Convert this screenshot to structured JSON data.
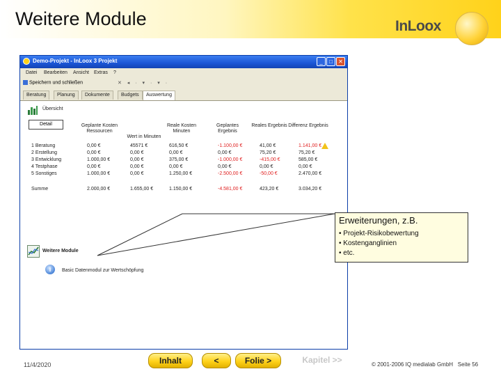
{
  "slide": {
    "title": "Weitere Module",
    "logo": "InLoox"
  },
  "window": {
    "title": "Demo-Projekt - InLoox 3 Projekt",
    "menu": [
      "Datei",
      "Bearbeiten",
      "Ansicht",
      "Extras",
      "?"
    ],
    "toolbar_save": "Speichern und schließen",
    "toolbar_icons": "✕ ◂ · ▾ · ▾ ·",
    "tabs": [
      "Beratung",
      "Planung",
      "Dokumente",
      "Budgets",
      "Auswertung"
    ],
    "overview_label": "Übersicht",
    "overview_button": "Detail",
    "columns": [
      "Geplante Kosten Ressourcen",
      "Wert in Minuten",
      "Reale Kosten Minuten",
      "Geplantes Ergebnis",
      "Reales Ergebnis",
      "Differenz Ergebnis"
    ],
    "rows": [
      {
        "label": "1 Beratung",
        "values": [
          "0,00 €",
          "45571 €",
          "616,50 €",
          "-1.100,00 €",
          "41,00 €",
          "1.141,00 €"
        ]
      },
      {
        "label": "2 Erstellung",
        "values": [
          "0,00 €",
          "0,00 €",
          "0,00 €",
          "0,00 €",
          "75,20 €",
          "75,20 €"
        ]
      },
      {
        "label": "3 Entwicklung",
        "values": [
          "1.000,00 €",
          "0,00 €",
          "375,00 €",
          "-1.000,00 €",
          "-415,00 €",
          "585,00 €"
        ]
      },
      {
        "label": "4 Testphase",
        "values": [
          "0,00 €",
          "0,00 €",
          "0,00 €",
          "0,00 €",
          "0,00 €",
          "0,00 €"
        ]
      },
      {
        "label": "5 Sonstiges",
        "values": [
          "1.000,00 €",
          "0,00 €",
          "1.250,00 €",
          "-2.500,00 €",
          "-50,00 €",
          "2.470,00 €"
        ]
      }
    ],
    "sum": {
      "label": "Summe",
      "values": [
        "2.000,00 €",
        "1.655,00 €",
        "1.150,00 €",
        "-4.581,00 €",
        "423,20 €",
        "3.034,20 €"
      ]
    },
    "module_label": "Weitere Module",
    "info_text": "Basic Datenmodul zur Wertschöpfung"
  },
  "callout": {
    "title": "Erweiterungen, z.B.",
    "items": [
      "• Projekt-Risikobewertung",
      "• Kostenganglinien",
      "• etc."
    ]
  },
  "footer": {
    "date": "11/4/2020",
    "btn_inhalt": "Inhalt",
    "btn_back": "<",
    "btn_folie": "Folie >",
    "btn_kapitel": "Kapitel >>",
    "copyright": "© 2001-2006 IQ medialab GmbH",
    "page": "Seite 56"
  },
  "colors": {
    "accent": "#ffd21a",
    "titlebar": "#1b55d6",
    "negative": "#e02020"
  }
}
